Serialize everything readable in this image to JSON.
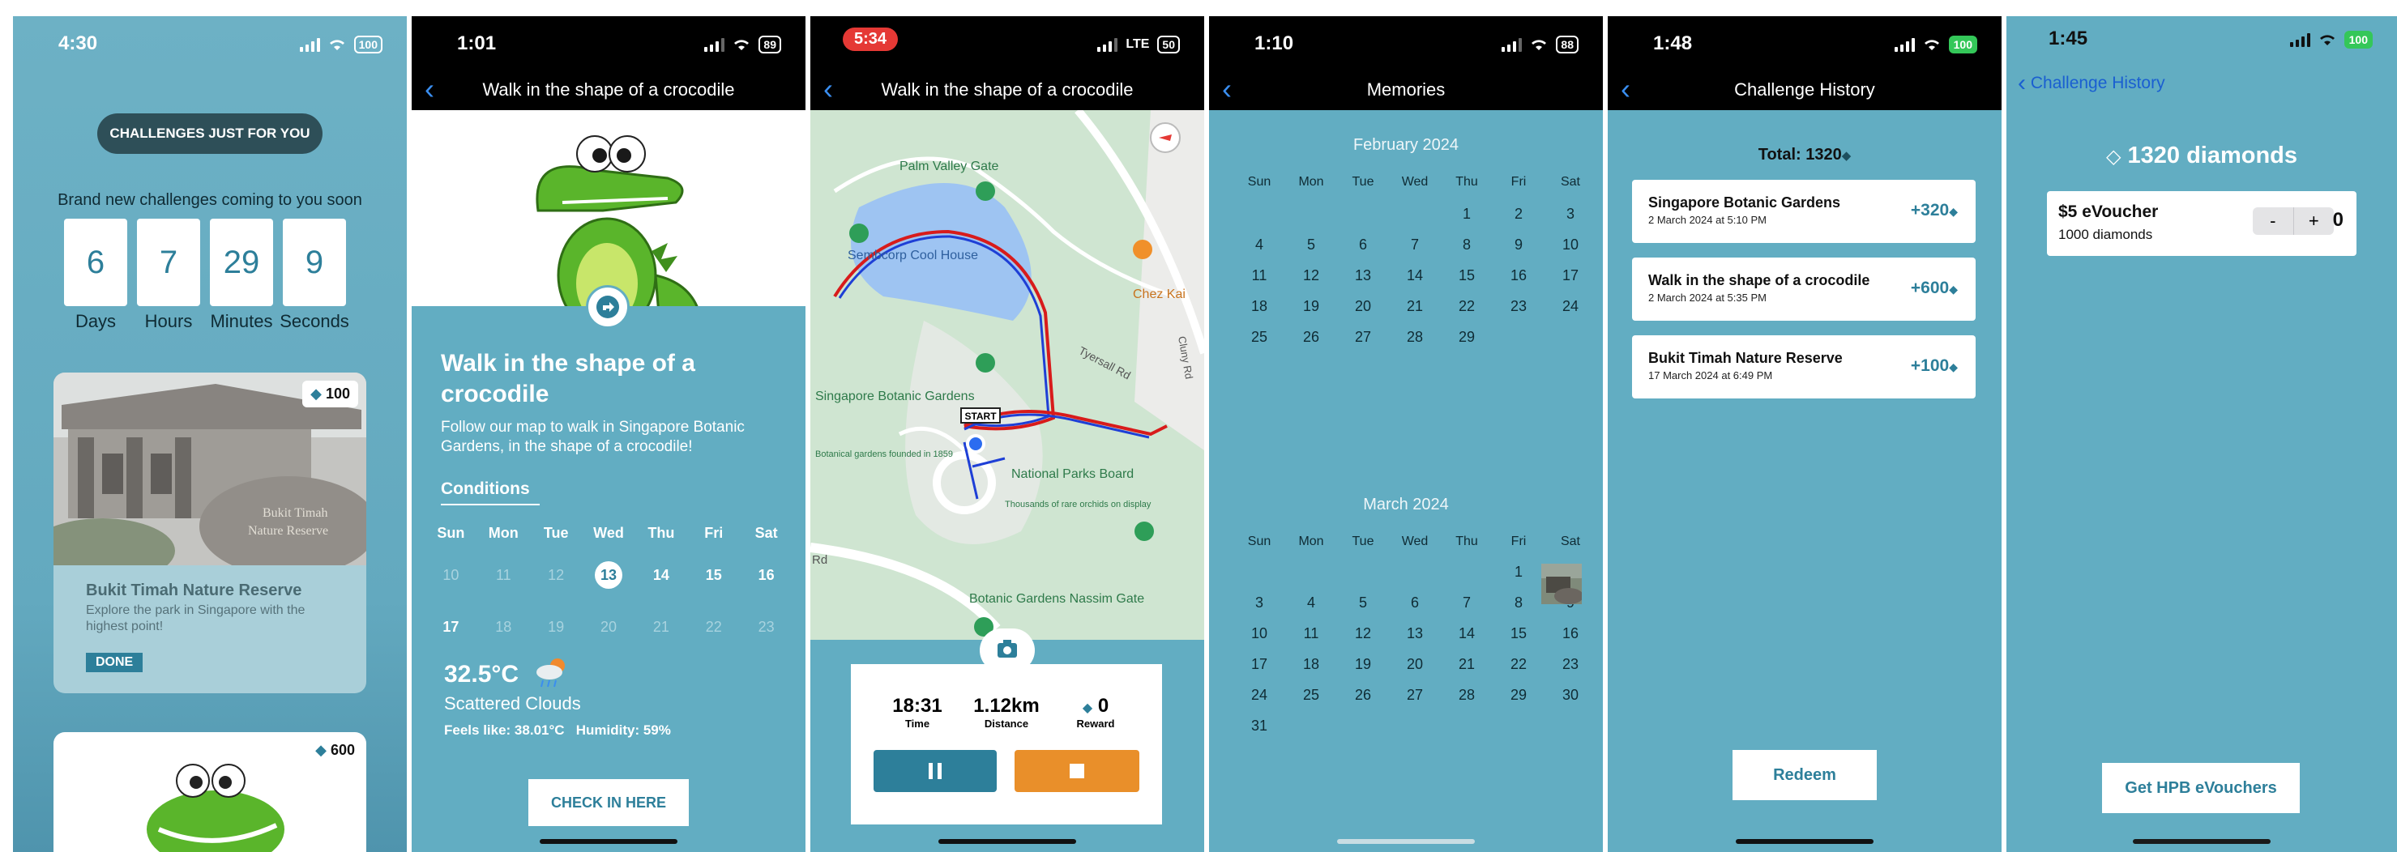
{
  "colors": {
    "teal": "#62adc2",
    "dark_teal": "#2d7f9a",
    "orange": "#e98f2a",
    "ios_blue": "#3a8ef0"
  },
  "phone1": {
    "time": "4:30",
    "battery": "100",
    "header_chip": "CHALLENGES JUST FOR YOU",
    "coming_soon": "Brand new challenges coming to you soon",
    "countdown": [
      {
        "value": "6",
        "label": "Days"
      },
      {
        "value": "7",
        "label": "Hours"
      },
      {
        "value": "29",
        "label": "Minutes"
      },
      {
        "value": "9",
        "label": "Seconds"
      }
    ],
    "card1": {
      "reward": "100",
      "title": "Bukit Timah Nature Reserve",
      "desc": "Explore the park in Singapore with the highest point!",
      "badge": "DONE",
      "sign_text": "Bukit Timah Nature Reserve"
    },
    "card2": {
      "reward": "600"
    }
  },
  "phone2": {
    "time": "1:01",
    "battery": "89",
    "nav_title": "Walk in the shape of a crocodile",
    "title": "Walk in the shape of a crocodile",
    "desc": "Follow our map to walk in Singapore Botanic Gardens, in the shape of a crocodile!",
    "conditions_label": "Conditions",
    "weekdays": [
      "Sun",
      "Mon",
      "Tue",
      "Wed",
      "Thu",
      "Fri",
      "Sat"
    ],
    "week1": [
      "10",
      "11",
      "12",
      "13",
      "14",
      "15",
      "16"
    ],
    "week2": [
      "17",
      "18",
      "19",
      "20",
      "21",
      "22",
      "23"
    ],
    "temperature": "32.5°C",
    "weather": "Scattered Clouds",
    "feels_like": "Feels like: 38.01°C",
    "humidity": "Humidity: 59%",
    "checkin": "CHECK IN HERE"
  },
  "phone3": {
    "time": "5:34",
    "network": "LTE",
    "battery": "50",
    "nav_title": "Walk in the shape of a crocodile",
    "map_labels": {
      "palm_valley": "Palm Valley Gate",
      "sembcorp": "Sembcorp Cool House",
      "chez_kai": "Chez Kai",
      "tyersall": "Tyersall Rd",
      "cluny": "Cluny Rd",
      "sbg": "Singapore Botanic Gardens",
      "sbg_sub": "Botanical gardens founded in 1859",
      "start": "START",
      "npb": "National Parks Board",
      "npb_sub": "Thousands of rare orchids on display",
      "nassim": "Botanic Gardens Nassim Gate",
      "rd": "Rd"
    },
    "time_value": "18:31",
    "time_label": "Time",
    "distance_value": "1.12km",
    "distance_label": "Distance",
    "reward_value": "0",
    "reward_label": "Reward"
  },
  "phone4": {
    "time": "1:10",
    "battery": "88",
    "nav_title": "Memories",
    "weekdays": [
      "Sun",
      "Mon",
      "Tue",
      "Wed",
      "Thu",
      "Fri",
      "Sat"
    ],
    "feb": {
      "label": "February 2024",
      "weeks": [
        [
          "",
          "",
          "",
          "",
          "1",
          "2",
          "3"
        ],
        [
          "4",
          "5",
          "6",
          "7",
          "8",
          "9",
          "10"
        ],
        [
          "11",
          "12",
          "13",
          "14",
          "15",
          "16",
          "17"
        ],
        [
          "18",
          "19",
          "20",
          "21",
          "22",
          "23",
          "24"
        ],
        [
          "25",
          "26",
          "27",
          "28",
          "29",
          "",
          ""
        ]
      ]
    },
    "mar": {
      "label": "March 2024",
      "weeks": [
        [
          "",
          "",
          "",
          "",
          "",
          "1",
          ""
        ],
        [
          "3",
          "4",
          "5",
          "6",
          "7",
          "8",
          "9"
        ],
        [
          "10",
          "11",
          "12",
          "13",
          "14",
          "15",
          "16"
        ],
        [
          "17",
          "18",
          "19",
          "20",
          "21",
          "22",
          "23"
        ],
        [
          "24",
          "25",
          "26",
          "27",
          "28",
          "29",
          "30"
        ],
        [
          "31",
          "",
          "",
          "",
          "",
          "",
          ""
        ]
      ]
    }
  },
  "phone5": {
    "time": "1:48",
    "battery": "100",
    "nav_title": "Challenge History",
    "total": "Total: 1320",
    "items": [
      {
        "title": "Singapore Botanic Gardens",
        "date": "2 March 2024 at 5:10 PM",
        "reward": "+320"
      },
      {
        "title": "Walk in the shape of a crocodile",
        "date": "2 March 2024 at 5:35 PM",
        "reward": "+600"
      },
      {
        "title": "Bukit Timah Nature Reserve",
        "date": "17 March 2024 at 6:49 PM",
        "reward": "+100"
      }
    ],
    "redeem": "Redeem"
  },
  "phone6": {
    "time": "1:45",
    "battery": "100",
    "back_label": "Challenge History",
    "diamonds": "1320 diamonds",
    "voucher_title": "$5 eVoucher",
    "voucher_cost": "1000 diamonds",
    "minus": "-",
    "plus": "+",
    "quantity": "0",
    "get_btn": "Get HPB eVouchers"
  }
}
